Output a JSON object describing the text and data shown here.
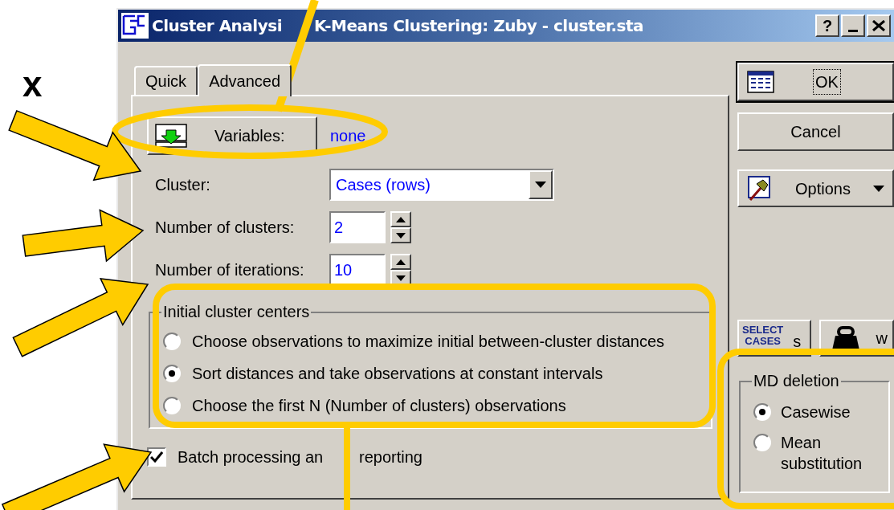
{
  "slide_text": "x",
  "window": {
    "title": [
      "Cluster Analysi",
      "K-Means Clustering: Zuby - cluster.sta"
    ],
    "help_button": "?"
  },
  "tabs": [
    {
      "label": "Quick",
      "selected": false
    },
    {
      "label": "Advanced",
      "selected": true
    }
  ],
  "variables": {
    "button": "Variables:",
    "value": "none"
  },
  "fields": [
    {
      "kind": "combo",
      "label": "Cluster:",
      "value": "Cases (rows)"
    },
    {
      "kind": "spin",
      "label": "Number of clusters:",
      "value": "2"
    },
    {
      "kind": "spin",
      "label": "Number of iterations:",
      "value": "10"
    }
  ],
  "initial_centers": {
    "title": "Initial cluster centers",
    "options": [
      {
        "label": "Choose observations to maximize initial between-cluster distances",
        "selected": false
      },
      {
        "label": "Sort distances and take observations at constant intervals",
        "selected": true
      },
      {
        "label": "Choose the first N (Number of clusters) observations",
        "selected": false
      }
    ]
  },
  "batch": {
    "label": [
      "Batch processing an",
      "reporting"
    ],
    "checked": true
  },
  "buttons": {
    "ok": "OK",
    "cancel": "Cancel",
    "options": "Options"
  },
  "select_cases": {
    "icon_text": [
      "SELECT",
      "CASES"
    ],
    "label": "s"
  },
  "weight": {
    "label": "w"
  },
  "md_deletion": {
    "title": "MD deletion",
    "options": [
      {
        "label": "Casewise",
        "selected": true
      },
      {
        "label": "Mean substitution",
        "selected": false
      }
    ]
  }
}
